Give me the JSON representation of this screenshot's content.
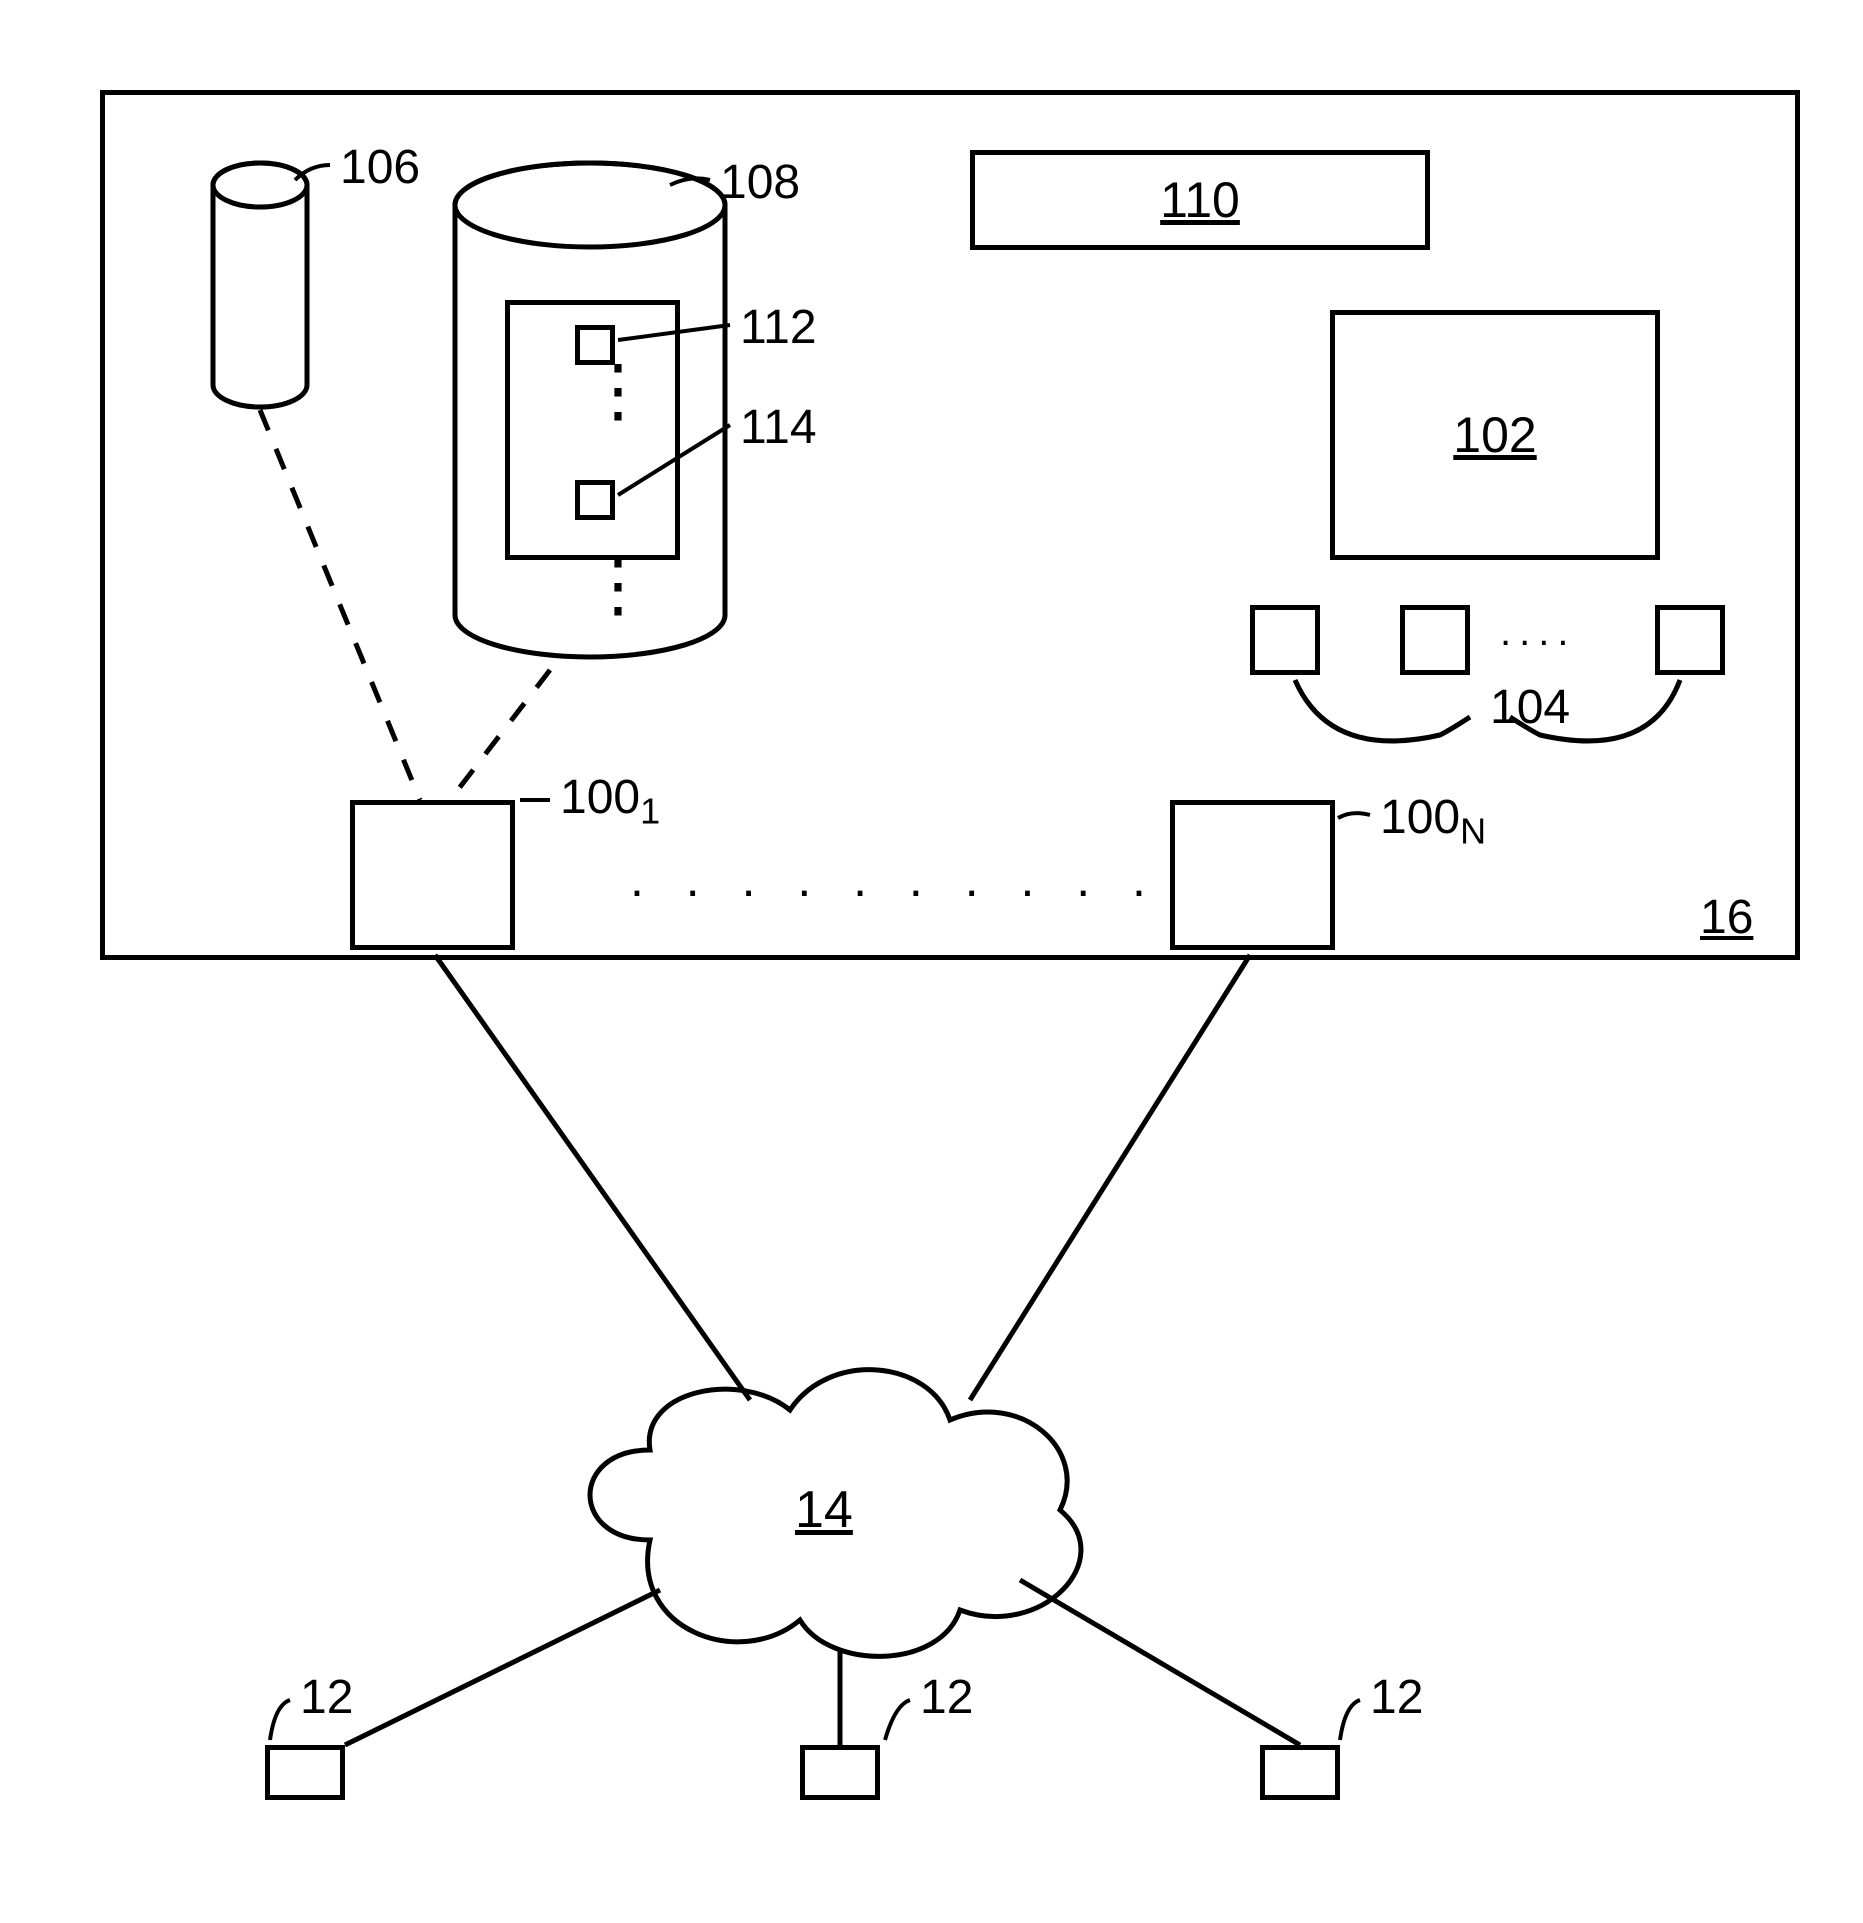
{
  "labels": {
    "106": "106",
    "108": "108",
    "110": "110",
    "112": "112",
    "114": "114",
    "102": "102",
    "104": "104",
    "100_1_prefix": "100",
    "100_1_sub": "1",
    "100_n_prefix": "100",
    "100_n_sub": "N",
    "16": "16",
    "14": "14",
    "12a": "12",
    "12b": "12",
    "12c": "12"
  },
  "dots": {
    "inner_sq": "⋮",
    "db_below": "⋮",
    "between_104": "....",
    "between_100": ". . . . . . . . . ."
  }
}
